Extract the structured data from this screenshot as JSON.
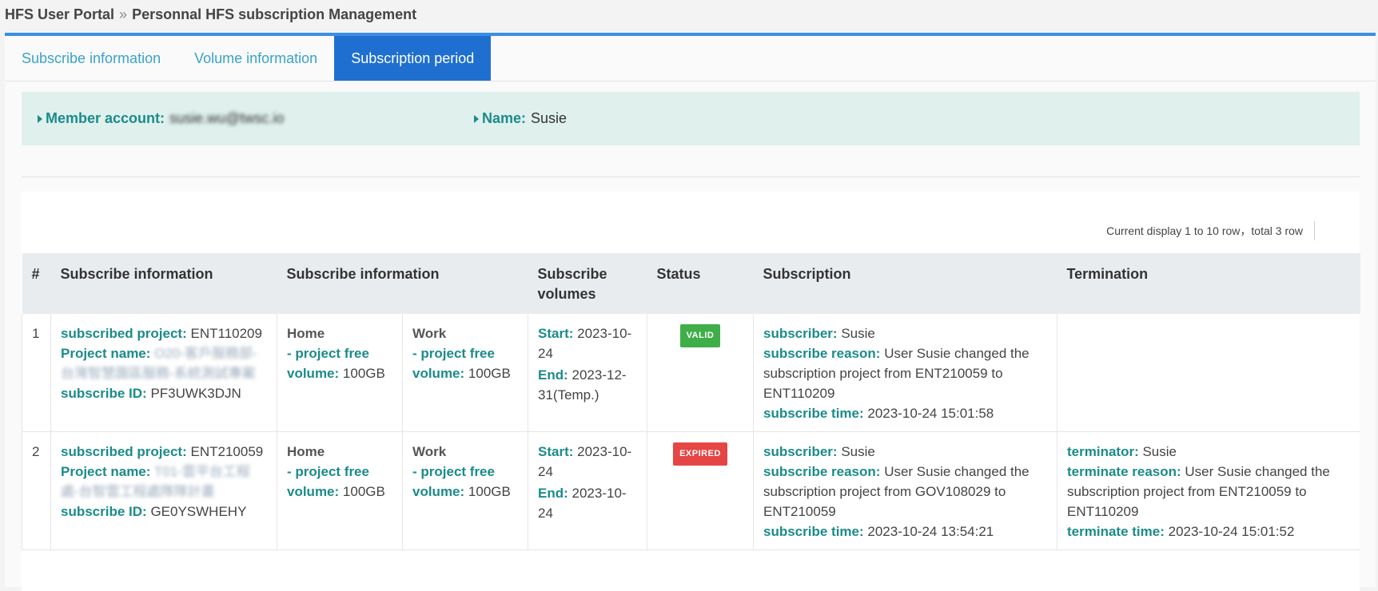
{
  "breadcrumb": {
    "root": "HFS User Portal",
    "separator": "»",
    "current": "Personnal HFS subscription Management"
  },
  "tabs": [
    {
      "label": "Subscribe information",
      "active": false
    },
    {
      "label": "Volume information",
      "active": false
    },
    {
      "label": "Subscription period",
      "active": true
    }
  ],
  "member": {
    "account_label": "Member account:",
    "account_value": "susie.wu@twsc.io",
    "name_label": "Name:",
    "name_value": "Susie"
  },
  "pagination": {
    "display_text": "Current display 1 to 10 row，total 3 row"
  },
  "table": {
    "headers": [
      "#",
      "Subscribe information",
      "Subscribe information",
      "",
      "Subscribe volumes",
      "Status",
      "Subscription",
      "Termination"
    ],
    "labels": {
      "subscribed_project": "subscribed project:",
      "project_name": "Project name:",
      "subscribe_id": "subscribe ID:",
      "home": "Home",
      "work": "Work",
      "free_volume_1": "- project free",
      "free_volume_2": "volume:",
      "start": "Start:",
      "end": "End:",
      "subscriber": "subscriber:",
      "subscribe_reason": "subscribe reason:",
      "subscribe_time": "subscribe time:",
      "terminator": "terminator:",
      "terminate_reason": "terminate reason:",
      "terminate_time": "terminate time:"
    },
    "rows": [
      {
        "num": "1",
        "subscribed_project": "ENT110209",
        "project_name": "O20-客戶服務部-台灣智慧園區服務-系統測試專案",
        "subscribe_id": "PF3UWK3DJN",
        "home_volume": "100GB",
        "work_volume": "100GB",
        "start": "2023-10-24",
        "end": "2023-12-31(Temp.)",
        "status": "VALID",
        "status_color": "#3fae49",
        "subscriber": "Susie",
        "subscribe_reason": "User Susie changed the subscription project from ENT210059 to ENT110209",
        "subscribe_time": "2023-10-24 15:01:58",
        "terminator": "",
        "terminate_reason": "",
        "terminate_time": ""
      },
      {
        "num": "2",
        "subscribed_project": "ENT210059",
        "project_name": "T01-雲平台工程處-台智雲工程處隊隊計畫",
        "subscribe_id": "GE0YSWHEHY",
        "home_volume": "100GB",
        "work_volume": "100GB",
        "start": "2023-10-24",
        "end": "2023-10-24",
        "status": "EXPIRED",
        "status_color": "#e64545",
        "subscriber": "Susie",
        "subscribe_reason": "User Susie changed the subscription project from GOV108029 to ENT210059",
        "subscribe_time": "2023-10-24 13:54:21",
        "terminator": "Susie",
        "terminate_reason": "User Susie changed the subscription project from ENT210059 to ENT110209",
        "terminate_time": "2023-10-24 15:01:52"
      }
    ]
  }
}
